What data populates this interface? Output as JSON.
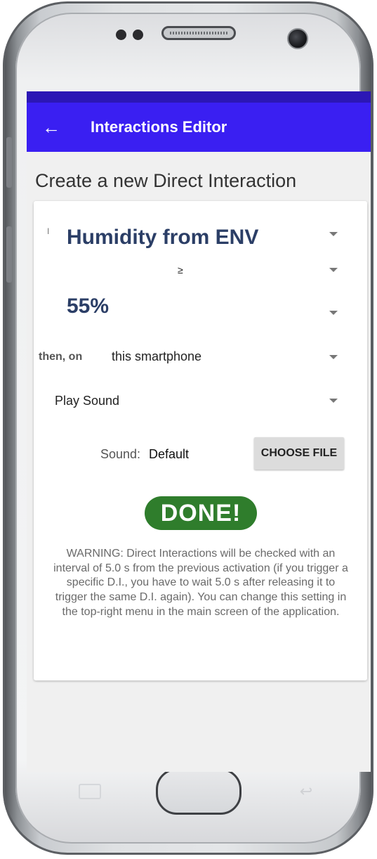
{
  "app_bar": {
    "title": "Interactions Editor",
    "back_icon": "arrow-left-icon",
    "color": "#3a1ff2"
  },
  "page_heading": "Create a new Direct Interaction",
  "form": {
    "first_row_prefix": "I",
    "source": "Humidity from ENV",
    "operator": "≥",
    "threshold": "55%",
    "device_label": "then, on",
    "device": "this smartphone",
    "action": "Play Sound",
    "sound_label": "Sound:",
    "sound_value": "Default",
    "choose_file_label": "CHOOSE FILE",
    "done_label": "DONE!",
    "done_color": "#2f7d2c"
  },
  "warning_text": "WARNING: Direct Interactions will be checked with an interval of 5.0 s from the previous activation (if you trigger a specific D.I., you have to wait 5.0 s after releasing it to trigger the same D.I. again). You can change this setting in the top-right menu in the main screen of the application."
}
